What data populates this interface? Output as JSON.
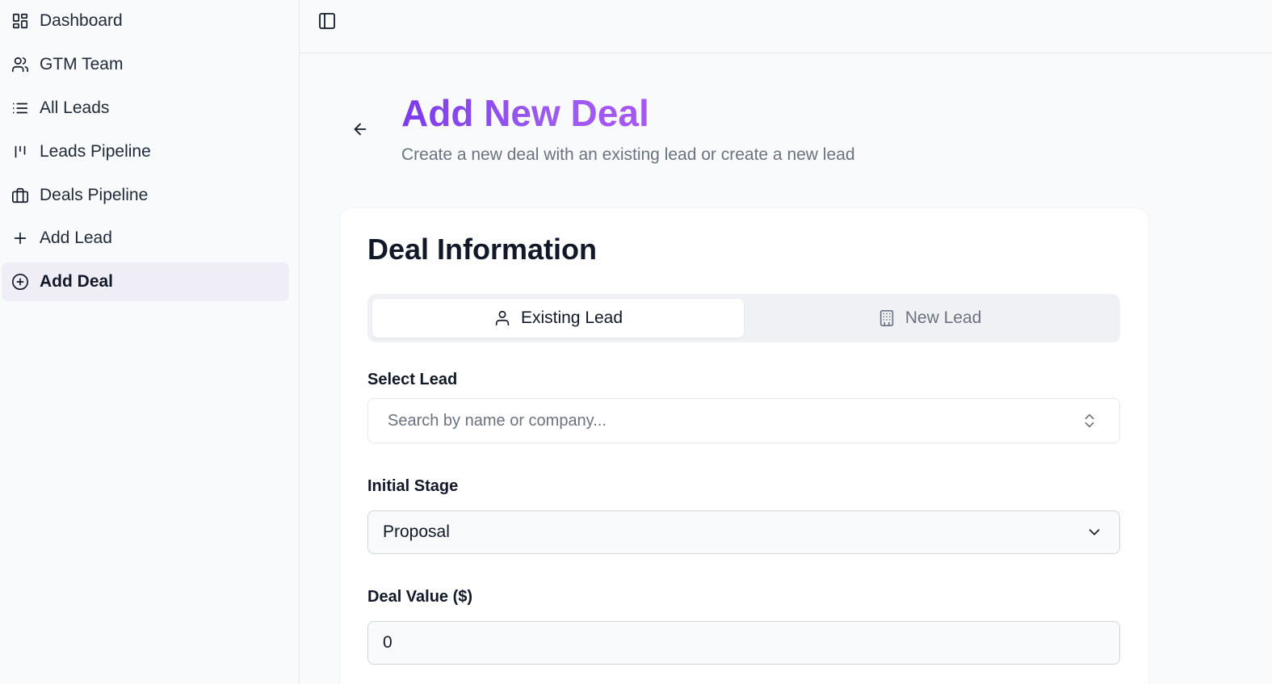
{
  "sidebar": {
    "items": [
      {
        "label": "Dashboard",
        "icon": "dashboard-icon"
      },
      {
        "label": "GTM Team",
        "icon": "users-icon"
      },
      {
        "label": "All Leads",
        "icon": "list-icon"
      },
      {
        "label": "Leads Pipeline",
        "icon": "kanban-icon"
      },
      {
        "label": "Deals Pipeline",
        "icon": "briefcase-icon"
      },
      {
        "label": "Add Lead",
        "icon": "plus-icon"
      },
      {
        "label": "Add Deal",
        "icon": "plus-circle-icon",
        "active": true
      }
    ]
  },
  "header": {
    "title": "Add New Deal",
    "subtitle": "Create a new deal with an existing lead or create a new lead"
  },
  "card": {
    "title": "Deal Information",
    "tabs": [
      {
        "label": "Existing Lead",
        "icon": "user-icon",
        "active": true
      },
      {
        "label": "New Lead",
        "icon": "building-icon",
        "active": false
      }
    ],
    "select_lead": {
      "label": "Select Lead",
      "placeholder": "Search by name or company..."
    },
    "initial_stage": {
      "label": "Initial Stage",
      "value": "Proposal"
    },
    "deal_value": {
      "label": "Deal Value ($)",
      "value": "0"
    }
  },
  "colors": {
    "accent_start": "#7c3aed",
    "accent_end": "#a855f7",
    "active_nav_bg": "#efedf6"
  }
}
